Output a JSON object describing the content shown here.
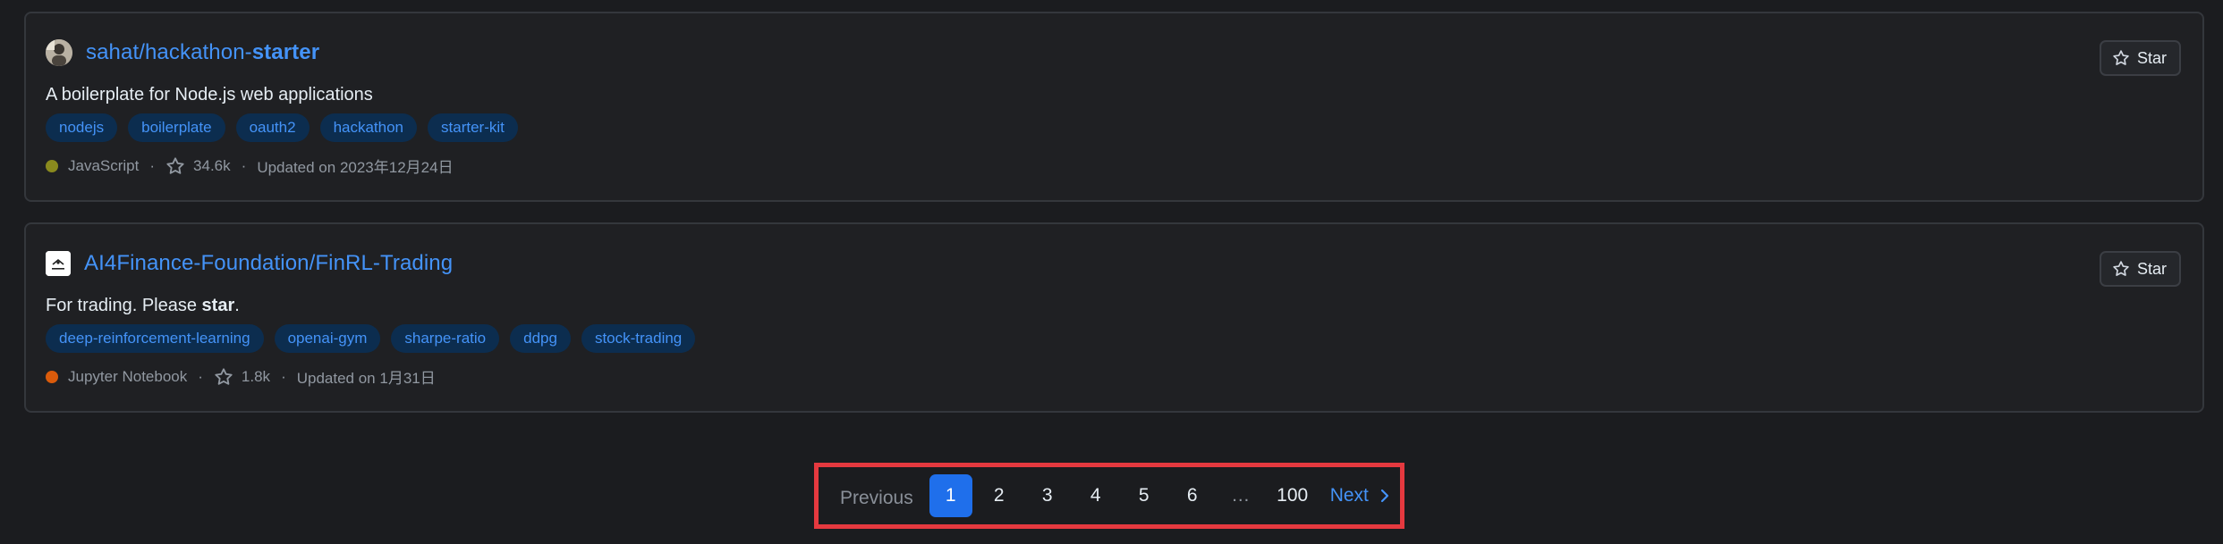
{
  "repos": [
    {
      "owner": "sahat/",
      "name_plain": "hackathon-",
      "name_strong": "starter",
      "description_plain": "A boilerplate for Node.js web applications",
      "description_strong": "",
      "description_tail": "",
      "topics": [
        "nodejs",
        "boilerplate",
        "oauth2",
        "hackathon",
        "starter-kit"
      ],
      "language": "JavaScript",
      "language_color": "#8a8a1e",
      "stars": "34.6k",
      "updated": "Updated on 2023年12月24日",
      "star_label": "Star"
    },
    {
      "owner": "AI4Finance-Foundation/",
      "name_plain": "FinRL-Trading",
      "name_strong": "",
      "description_plain": "For trading. Please ",
      "description_strong": "star",
      "description_tail": ".",
      "topics": [
        "deep-reinforcement-learning",
        "openai-gym",
        "sharpe-ratio",
        "ddpg",
        "stock-trading"
      ],
      "language": "Jupyter Notebook",
      "language_color": "#da5b0b",
      "stars": "1.8k",
      "updated": "Updated on 1月31日",
      "star_label": "Star"
    }
  ],
  "pagination": {
    "previous": "Previous",
    "pages": [
      "1",
      "2",
      "3",
      "4",
      "5",
      "6"
    ],
    "gap": "…",
    "last": "100",
    "next": "Next",
    "current": "1"
  }
}
